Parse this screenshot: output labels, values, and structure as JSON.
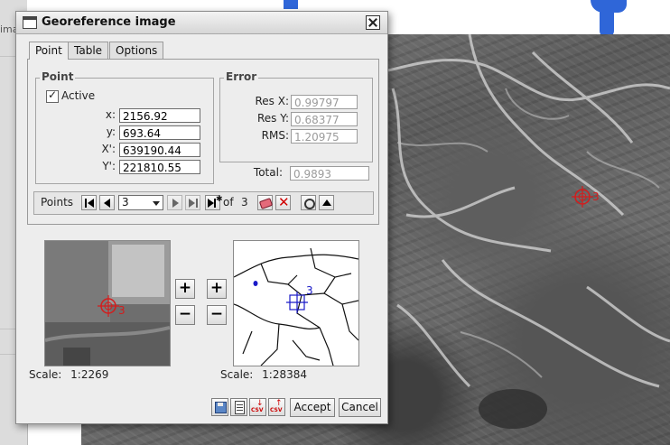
{
  "background": {
    "left_fragment": "image",
    "map_point_label": "3"
  },
  "dialog": {
    "title": "Georeference image",
    "tabs": [
      {
        "label": "Point",
        "active": true
      },
      {
        "label": "Table",
        "active": false
      },
      {
        "label": "Options",
        "active": false
      }
    ],
    "point_group": {
      "title": "Point",
      "active_label": "Active",
      "active_checked": true,
      "fields": [
        {
          "label": "x:",
          "value": "2156.92"
        },
        {
          "label": "y:",
          "value": "693.64"
        },
        {
          "label": "X':",
          "value": "639190.44"
        },
        {
          "label": "Y':",
          "value": "221810.55"
        }
      ]
    },
    "error_group": {
      "title": "Error",
      "fields": [
        {
          "label": "Res X:",
          "value": "0.99797"
        },
        {
          "label": "Res Y:",
          "value": "0.68377"
        },
        {
          "label": "RMS:",
          "value": "1.20975"
        }
      ],
      "total_label": "Total:",
      "total_value": "0.9893"
    },
    "points_bar": {
      "label": "Points",
      "selected": "3",
      "of_label": "of",
      "total": "3"
    },
    "image_viewer": {
      "point_label": "3",
      "scale_label": "Scale:",
      "scale_value": "1:2269"
    },
    "map_viewer": {
      "point_label": "3",
      "scale_label": "Scale:",
      "scale_value": "1:28384"
    },
    "zoom": {
      "in": "+",
      "out": "−"
    },
    "footer": {
      "csv_label": "CSV",
      "accept": "Accept",
      "cancel": "Cancel"
    }
  },
  "colors": {
    "target_red": "#d41c1c",
    "map_target_blue": "#1a1ac8",
    "delete_red": "#d00000",
    "background_blue": "#2f66d8"
  }
}
